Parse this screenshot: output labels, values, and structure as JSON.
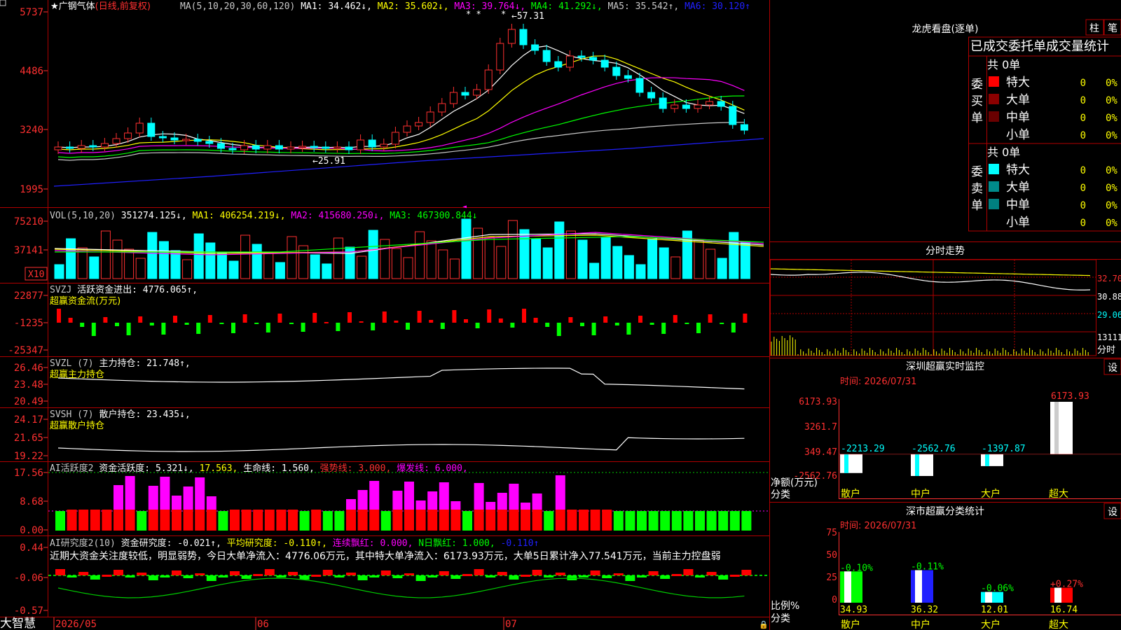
{
  "stock": {
    "title": "★广钢气体",
    "mode": "(日线,前复权)"
  },
  "price_panel": {
    "axis": [
      "5737",
      "4486",
      "3240",
      "1995"
    ],
    "ma_header": [
      {
        "text": "MA(5,10,20,30,60,120)",
        "color": "#c8c8c8"
      },
      {
        "text": "MA1: 34.462↓,",
        "color": "#ffffff"
      },
      {
        "text": "MA2: 35.602↓,",
        "color": "#ffff00"
      },
      {
        "text": "MA3: 39.764↓,",
        "color": "#ff00ff"
      },
      {
        "text": "MA4: 41.292↓,",
        "color": "#00ff00"
      },
      {
        "text": "MA5: 35.542↑,",
        "color": "#c8c8c8"
      },
      {
        "text": "MA6: 30.120↑",
        "color": "#2020ff"
      }
    ],
    "high_label": "←57.31",
    "low_label": "←25.91"
  },
  "vol_panel": {
    "axis": [
      "75210",
      "37141",
      "X10"
    ],
    "header": [
      {
        "text": "VOL(5,10,20)",
        "color": "#c8c8c8"
      },
      {
        "text": "351274.125↓,",
        "color": "#ffffff"
      },
      {
        "text": "MA1: 406254.219↓,",
        "color": "#ffff00"
      },
      {
        "text": "MA2: 415680.250↓,",
        "color": "#ff00ff"
      },
      {
        "text": "MA3: 467300.844↓",
        "color": "#00ff00"
      }
    ]
  },
  "svzj_panel": {
    "axis": [
      "22877",
      "-1235",
      "-25347"
    ],
    "header": [
      {
        "text": "SVZJ",
        "color": "#c8c8c8"
      },
      {
        "text": "活跃资金进出: 4776.065↑,",
        "color": "#ffffff"
      }
    ],
    "subtitle": "超赢资金流(万元)"
  },
  "svzl_panel": {
    "axis": [
      "26.46",
      "23.48",
      "20.49"
    ],
    "header": [
      {
        "text": "SVZL (7)",
        "color": "#c8c8c8"
      },
      {
        "text": "主力持仓: 21.748↑,",
        "color": "#ffffff"
      }
    ],
    "subtitle": "超赢主力持仓"
  },
  "svsh_panel": {
    "axis": [
      "24.17",
      "21.65",
      "19.22"
    ],
    "header": [
      {
        "text": "SVSH (7)",
        "color": "#c8c8c8"
      },
      {
        "text": "散户持仓: 23.435↓,",
        "color": "#ffffff"
      }
    ],
    "subtitle": "超赢散户持仓"
  },
  "ai_active_panel": {
    "axis": [
      "17.56",
      "8.68",
      "0.00"
    ],
    "header": [
      {
        "text": "AI活跃度2",
        "color": "#c8c8c8"
      },
      {
        "text": "资金活跃度: 5.321↓,",
        "color": "#ffffff"
      },
      {
        "text": "17.563,",
        "color": "#ffff00"
      },
      {
        "text": "生命线: 1.560,",
        "color": "#ffffff"
      },
      {
        "text": "强势线: 3.000,",
        "color": "#ff3030"
      },
      {
        "text": "爆发线: 6.000,",
        "color": "#ff00ff"
      }
    ]
  },
  "ai_research_panel": {
    "axis": [
      "0.44",
      "-0.06",
      "-0.57"
    ],
    "header": [
      {
        "text": "AI研究度2(10)",
        "color": "#c8c8c8"
      },
      {
        "text": "资金研究度: -0.021↑,",
        "color": "#ffffff"
      },
      {
        "text": "平均研究度: -0.110↑,",
        "color": "#ffff00"
      },
      {
        "text": "连续飘红: 0.000,",
        "color": "#ff00ff"
      },
      {
        "text": "N日飘红: 1.000,",
        "color": "#00ff00"
      },
      {
        "text": "-0.110↑",
        "color": "#2020ff"
      }
    ],
    "summary": "近期大资金关注度较低，明显弱势，今日大单净流入：4776.06万元，其中特大单净流入：6173.93万元，大单5日累计净入77.541万元，当前主力控盘弱"
  },
  "bottom_axis": {
    "logo": "大智慧",
    "dates": [
      "2026/05",
      "06",
      "07"
    ]
  },
  "longhu": {
    "title": "龙虎看盘(逐单)",
    "btn_col": "柱",
    "btn_row": "笔",
    "headline": "已成交委托单成交量统计",
    "buy_label": "委买单",
    "sell_label": "委卖单",
    "buy_total": "共 0单",
    "sell_total": "共 0单",
    "buy_rows": [
      {
        "name": "特大",
        "count": "0",
        "pct": "0%",
        "color": "#ff0000"
      },
      {
        "name": "大单",
        "count": "0",
        "pct": "0%",
        "color": "#8b0000"
      },
      {
        "name": "中单",
        "count": "0",
        "pct": "0%",
        "color": "#6a0000"
      },
      {
        "name": "小单",
        "count": "0",
        "pct": "0%",
        "color": ""
      }
    ],
    "sell_rows": [
      {
        "name": "特大",
        "count": "0",
        "pct": "0%",
        "color": "#00ffff"
      },
      {
        "name": "大单",
        "count": "0",
        "pct": "0%",
        "color": "#008b8b"
      },
      {
        "name": "中单",
        "count": "0",
        "pct": "0%",
        "color": "#008080"
      },
      {
        "name": "小单",
        "count": "0",
        "pct": "0%",
        "color": ""
      }
    ]
  },
  "intraday": {
    "title": "分时走势",
    "axis": [
      "32.70",
      "30.88",
      "29.06"
    ],
    "vol_axis": "13111",
    "vol_unit": "分时"
  },
  "sz_monitor": {
    "title": "深圳超赢实时监控",
    "settings": "设",
    "time": "时间: 2026/07/31",
    "axis": [
      "6173.93",
      "3261.7",
      "349.47",
      "-2562.76"
    ],
    "y_label": "净额(万元)",
    "x_label": "分类",
    "categories": [
      "散户",
      "中户",
      "大户",
      "超大"
    ],
    "values": [
      -2213.29,
      -2562.76,
      -1397.87,
      6173.93
    ],
    "value_labels": [
      "-2213.29",
      "-2562.76",
      "-1397.87",
      "6173.93"
    ]
  },
  "class_stats": {
    "title": "深市超赢分类统计",
    "settings": "设",
    "time": "时间: 2026/07/31",
    "axis": [
      "75",
      "50",
      "25",
      "0"
    ],
    "y_label": "比例%",
    "x_label": "分类",
    "categories": [
      "散户",
      "中户",
      "大户",
      "超大"
    ],
    "values": [
      34.93,
      36.32,
      12.01,
      16.74
    ],
    "value_labels": [
      "34.93",
      "36.32",
      "12.01",
      "16.74"
    ],
    "change_labels": [
      "-0.10%",
      "-0.11%",
      "-0.06%",
      "+0.27%"
    ]
  },
  "chart_data": {
    "type": "bar",
    "title": "深圳超赢实时监控",
    "categories": [
      "散户",
      "中户",
      "大户",
      "超大"
    ],
    "values": [
      -2213.29,
      -2562.76,
      -1397.87,
      6173.93
    ],
    "xlabel": "分类",
    "ylabel": "净额(万元)",
    "ylim": [
      -2562.76,
      6173.93
    ]
  }
}
